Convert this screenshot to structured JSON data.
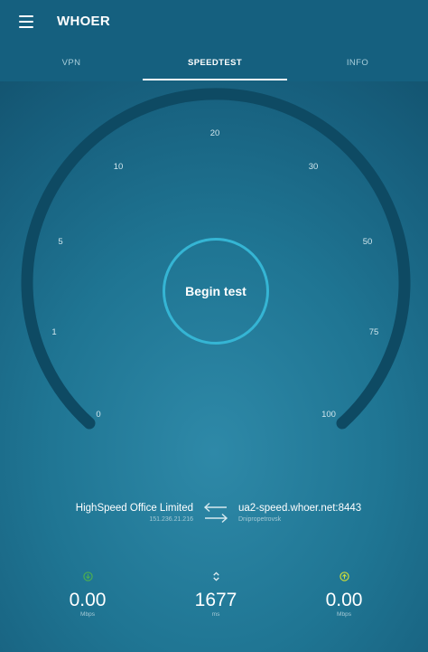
{
  "app": {
    "title": "WHOER"
  },
  "tabs": [
    {
      "label": "VPN"
    },
    {
      "label": "SPEEDTEST",
      "active": true
    },
    {
      "label": "INFO"
    }
  ],
  "gauge": {
    "ticks": [
      "0",
      "1",
      "5",
      "10",
      "20",
      "30",
      "50",
      "75",
      "100"
    ],
    "begin_label": "Begin test"
  },
  "server": {
    "local_name": "HighSpeed Office Limited",
    "local_ip": "151.236.21.216",
    "remote_host": "ua2-speed.whoer.net:8443",
    "remote_city": "Dnipropetrovsk"
  },
  "stats": {
    "download": {
      "value": "0.00",
      "unit": "Mbps",
      "icon": "download-icon",
      "color": "#4caf50"
    },
    "ping": {
      "value": "1677",
      "unit": "ms",
      "icon": "ping-icon"
    },
    "upload": {
      "value": "0.00",
      "unit": "Mbps",
      "icon": "upload-icon",
      "color": "#cddc39"
    }
  },
  "colors": {
    "appbar": "#15607f",
    "background": "#1f7593",
    "gauge_track": "#0e4a63",
    "button_ring": "#35b5d4"
  }
}
